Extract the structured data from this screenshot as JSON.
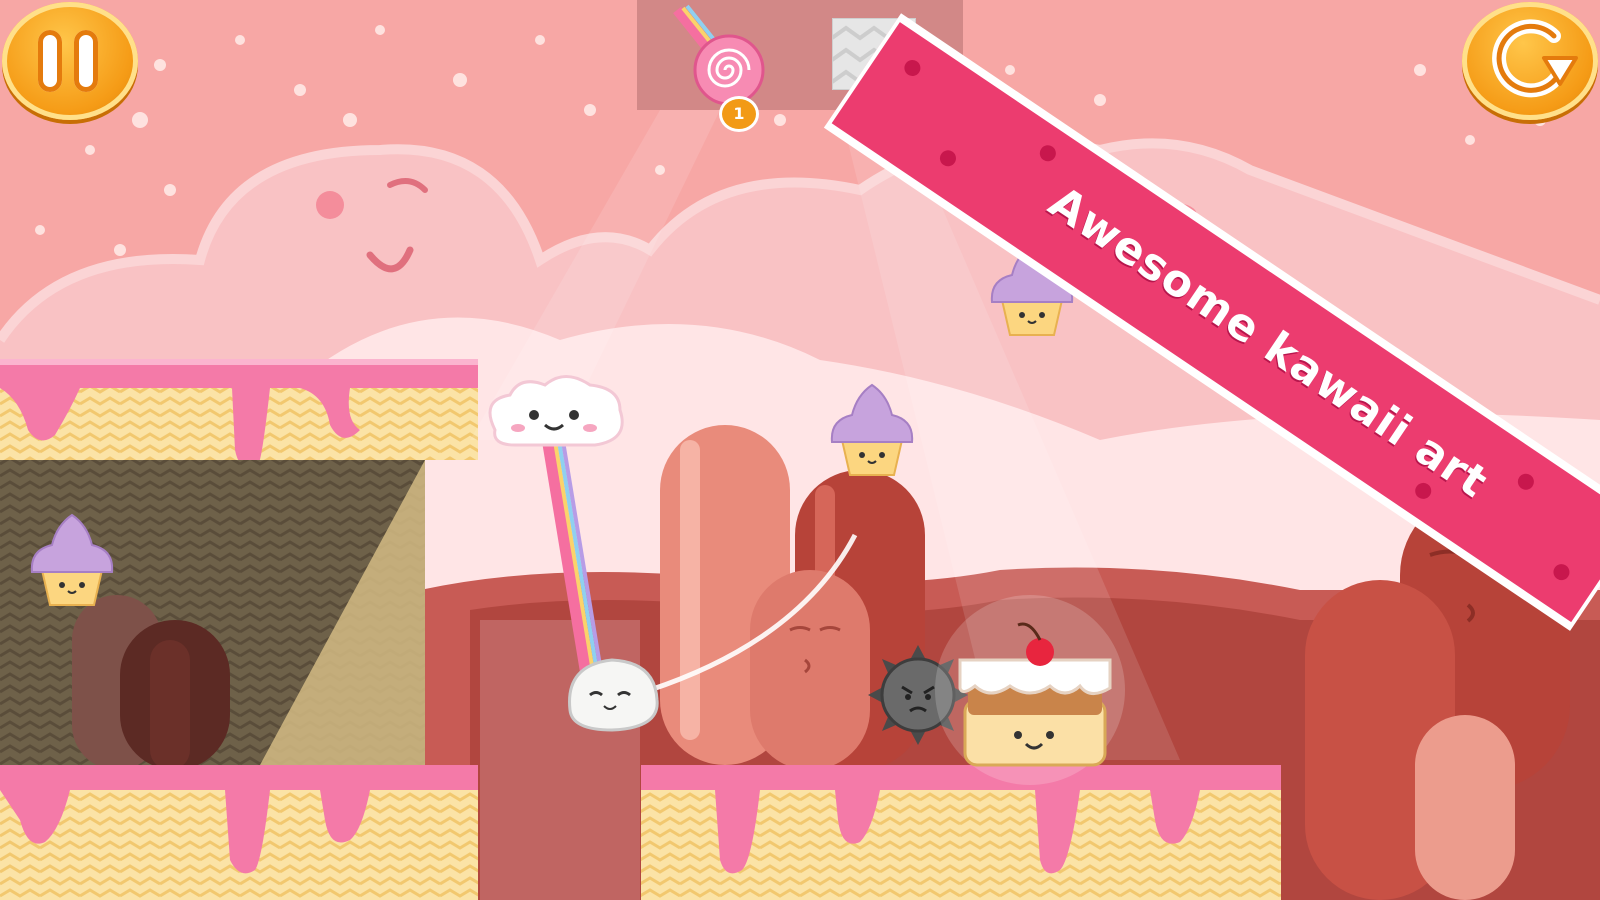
{
  "hud": {
    "pause_icon": "pause-icon",
    "restart_icon": "restart-icon"
  },
  "items": {
    "lollipop": {
      "icon": "rainbow-lollipop-icon",
      "count": "1"
    },
    "block": {
      "icon": "zigzag-block-icon"
    }
  },
  "banner": {
    "text": "Awesome kawaii art",
    "color": "#ec3c6f"
  },
  "colors": {
    "sky": "#f7a7a5",
    "cloud": "#f9c2c4",
    "icing": "#f47aa8",
    "wafer": "#fbe3a6",
    "accent": "#f59b16"
  }
}
